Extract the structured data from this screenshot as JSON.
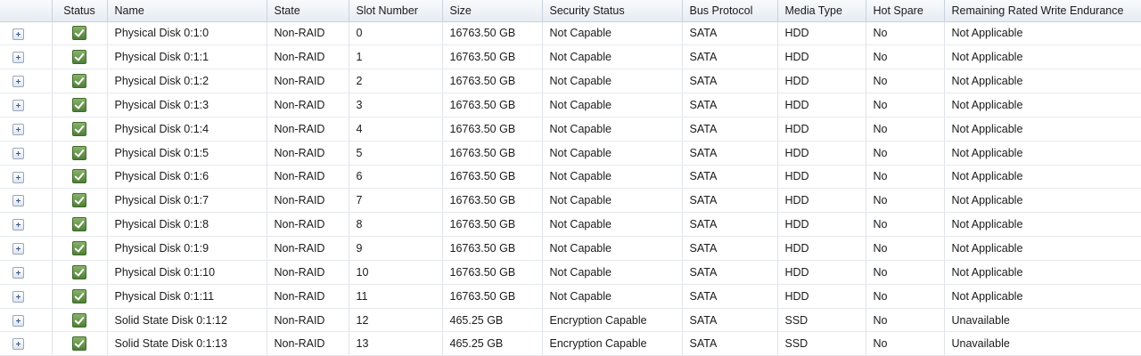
{
  "table": {
    "columns": {
      "expand": "",
      "status": "Status",
      "name": "Name",
      "state": "State",
      "slot": "Slot Number",
      "size": "Size",
      "security": "Security Status",
      "bus": "Bus Protocol",
      "media": "Media Type",
      "hot_spare": "Hot Spare",
      "endurance": "Remaining Rated Write Endurance"
    },
    "status_icon": "ok-check-icon",
    "status_color": "#5b8a3e",
    "rows": [
      {
        "name": "Physical Disk 0:1:0",
        "state": "Non-RAID",
        "slot": "0",
        "size": "16763.50 GB",
        "security": "Not Capable",
        "bus": "SATA",
        "media": "HDD",
        "hot_spare": "No",
        "endurance": "Not Applicable"
      },
      {
        "name": "Physical Disk 0:1:1",
        "state": "Non-RAID",
        "slot": "1",
        "size": "16763.50 GB",
        "security": "Not Capable",
        "bus": "SATA",
        "media": "HDD",
        "hot_spare": "No",
        "endurance": "Not Applicable"
      },
      {
        "name": "Physical Disk 0:1:2",
        "state": "Non-RAID",
        "slot": "2",
        "size": "16763.50 GB",
        "security": "Not Capable",
        "bus": "SATA",
        "media": "HDD",
        "hot_spare": "No",
        "endurance": "Not Applicable"
      },
      {
        "name": "Physical Disk 0:1:3",
        "state": "Non-RAID",
        "slot": "3",
        "size": "16763.50 GB",
        "security": "Not Capable",
        "bus": "SATA",
        "media": "HDD",
        "hot_spare": "No",
        "endurance": "Not Applicable"
      },
      {
        "name": "Physical Disk 0:1:4",
        "state": "Non-RAID",
        "slot": "4",
        "size": "16763.50 GB",
        "security": "Not Capable",
        "bus": "SATA",
        "media": "HDD",
        "hot_spare": "No",
        "endurance": "Not Applicable"
      },
      {
        "name": "Physical Disk 0:1:5",
        "state": "Non-RAID",
        "slot": "5",
        "size": "16763.50 GB",
        "security": "Not Capable",
        "bus": "SATA",
        "media": "HDD",
        "hot_spare": "No",
        "endurance": "Not Applicable"
      },
      {
        "name": "Physical Disk 0:1:6",
        "state": "Non-RAID",
        "slot": "6",
        "size": "16763.50 GB",
        "security": "Not Capable",
        "bus": "SATA",
        "media": "HDD",
        "hot_spare": "No",
        "endurance": "Not Applicable"
      },
      {
        "name": "Physical Disk 0:1:7",
        "state": "Non-RAID",
        "slot": "7",
        "size": "16763.50 GB",
        "security": "Not Capable",
        "bus": "SATA",
        "media": "HDD",
        "hot_spare": "No",
        "endurance": "Not Applicable"
      },
      {
        "name": "Physical Disk 0:1:8",
        "state": "Non-RAID",
        "slot": "8",
        "size": "16763.50 GB",
        "security": "Not Capable",
        "bus": "SATA",
        "media": "HDD",
        "hot_spare": "No",
        "endurance": "Not Applicable"
      },
      {
        "name": "Physical Disk 0:1:9",
        "state": "Non-RAID",
        "slot": "9",
        "size": "16763.50 GB",
        "security": "Not Capable",
        "bus": "SATA",
        "media": "HDD",
        "hot_spare": "No",
        "endurance": "Not Applicable"
      },
      {
        "name": "Physical Disk 0:1:10",
        "state": "Non-RAID",
        "slot": "10",
        "size": "16763.50 GB",
        "security": "Not Capable",
        "bus": "SATA",
        "media": "HDD",
        "hot_spare": "No",
        "endurance": "Not Applicable"
      },
      {
        "name": "Physical Disk 0:1:11",
        "state": "Non-RAID",
        "slot": "11",
        "size": "16763.50 GB",
        "security": "Not Capable",
        "bus": "SATA",
        "media": "HDD",
        "hot_spare": "No",
        "endurance": "Not Applicable"
      },
      {
        "name": "Solid State Disk 0:1:12",
        "state": "Non-RAID",
        "slot": "12",
        "size": "465.25 GB",
        "security": "Encryption Capable",
        "bus": "SATA",
        "media": "SSD",
        "hot_spare": "No",
        "endurance": "Unavailable"
      },
      {
        "name": "Solid State Disk 0:1:13",
        "state": "Non-RAID",
        "slot": "13",
        "size": "465.25 GB",
        "security": "Encryption Capable",
        "bus": "SATA",
        "media": "SSD",
        "hot_spare": "No",
        "endurance": "Unavailable"
      }
    ]
  }
}
